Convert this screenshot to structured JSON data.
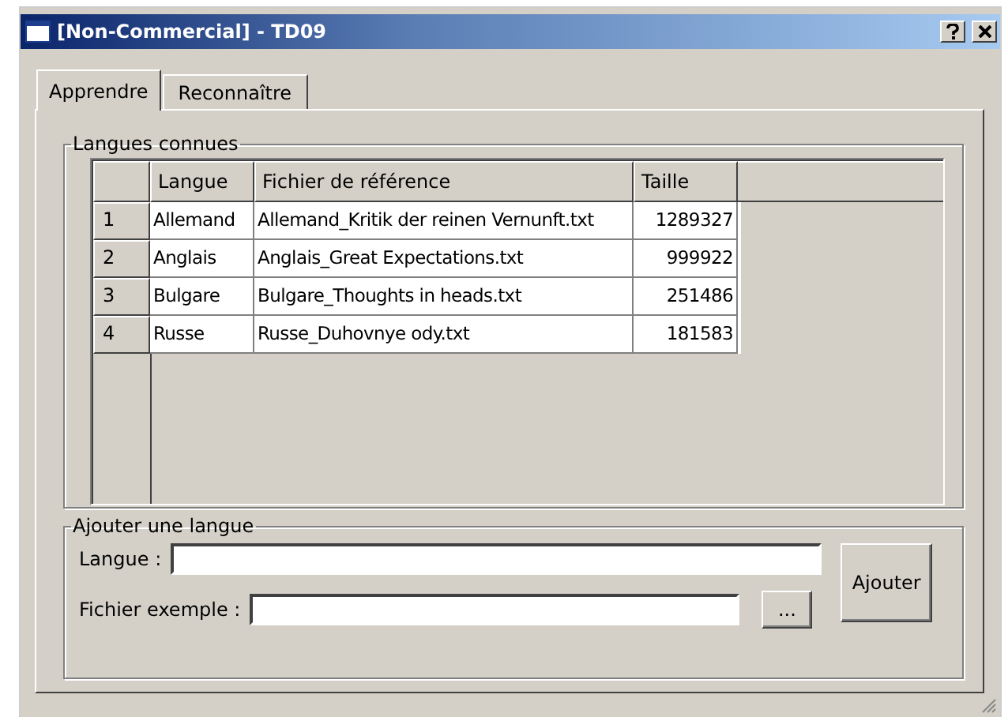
{
  "window": {
    "title": "[Non-Commercial] - TD09"
  },
  "tabs": [
    {
      "label": "Apprendre",
      "selected": true
    },
    {
      "label": "Reconnaître",
      "selected": false
    }
  ],
  "known_languages": {
    "title": "Langues connues",
    "columns": [
      "Langue",
      "Fichier de référence",
      "Taille"
    ],
    "rows": [
      {
        "index": "1",
        "cells": [
          "Allemand",
          "Allemand_Kritik der reinen Vernunft.txt",
          "1289327"
        ]
      },
      {
        "index": "2",
        "cells": [
          "Anglais",
          "Anglais_Great Expectations.txt",
          "999922"
        ]
      },
      {
        "index": "3",
        "cells": [
          "Bulgare",
          "Bulgare_Thoughts in heads.txt",
          "251486"
        ]
      },
      {
        "index": "4",
        "cells": [
          "Russe",
          "Russe_Duhovnye ody.txt",
          "181583"
        ]
      }
    ]
  },
  "add_language": {
    "title": "Ajouter une langue",
    "language_label": "Langue :",
    "file_label": "Fichier exemple :",
    "browse_button": "...",
    "add_button": "Ajouter"
  }
}
